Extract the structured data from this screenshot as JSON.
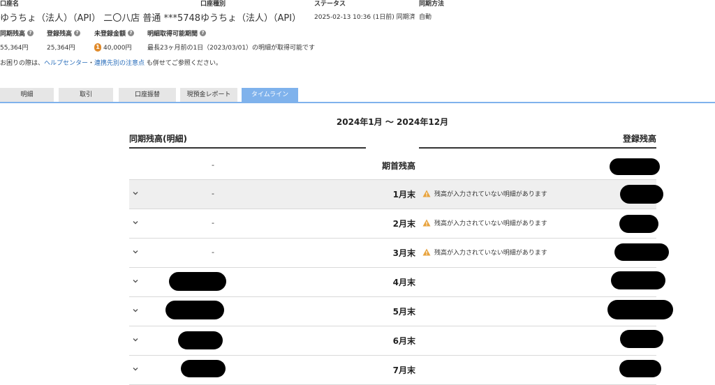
{
  "account": {
    "name_label": "口座名",
    "name_value": "ゆうちょ（法人）（API） 二〇八店 普通 ***5748",
    "type_label": "口座種別",
    "type_value": "ゆうちょ（法人）（API）",
    "status_label": "ステータス",
    "status_value": "2025-02-13 10:36 (1日前) 同期済",
    "sync_method_label": "同期方法",
    "sync_method_value": "自動"
  },
  "balances": {
    "synced_label": "同期残高",
    "synced_value": "55,364円",
    "registered_label": "登録残高",
    "registered_value": "25,364円",
    "unregistered_label": "未登録金額",
    "unregistered_badge": "1",
    "unregistered_value": "40,000円",
    "period_label": "明細取得可能期間",
    "period_value": "最長23ヶ月前の1日（2023/03/01）の明細が取得可能です",
    "help_icon": "question-circle-icon"
  },
  "help": {
    "prefix": "お困りの際は、",
    "link1": "ヘルプセンター",
    "separator": "・",
    "link2": "連携先別の注意点",
    "suffix": " も併せてご参照ください。"
  },
  "tabs": [
    {
      "label": "明細",
      "active": false
    },
    {
      "label": "取引",
      "active": false
    },
    {
      "label": "口座振替",
      "active": false
    },
    {
      "label": "現預金レポート",
      "active": false
    },
    {
      "label": "タイムライン",
      "active": true
    }
  ],
  "timeline": {
    "period_title": "2024年1月 〜 2024年12月",
    "left_header": "同期残高(明細)",
    "right_header": "登録残高",
    "opening": {
      "sync": "-",
      "label": "期首残高"
    },
    "warning_text": "残高が入力されていない明細があります",
    "rows": [
      {
        "month": "1月末",
        "sync": "-",
        "warning": true,
        "highlight": true
      },
      {
        "month": "2月末",
        "sync": "-",
        "warning": true,
        "highlight": false
      },
      {
        "month": "3月末",
        "sync": "-",
        "warning": true,
        "highlight": false
      },
      {
        "month": "4月末",
        "sync": "",
        "warning": false,
        "highlight": false
      },
      {
        "month": "5月末",
        "sync": "",
        "warning": false,
        "highlight": false
      },
      {
        "month": "6月末",
        "sync": "",
        "warning": false,
        "highlight": false
      },
      {
        "month": "7月末",
        "sync": "",
        "warning": false,
        "highlight": false
      }
    ]
  },
  "colors": {
    "accent": "#7fb2ec",
    "link": "#2a6ebb",
    "warning": "#e8a33d",
    "badge": "#e08a2a"
  }
}
